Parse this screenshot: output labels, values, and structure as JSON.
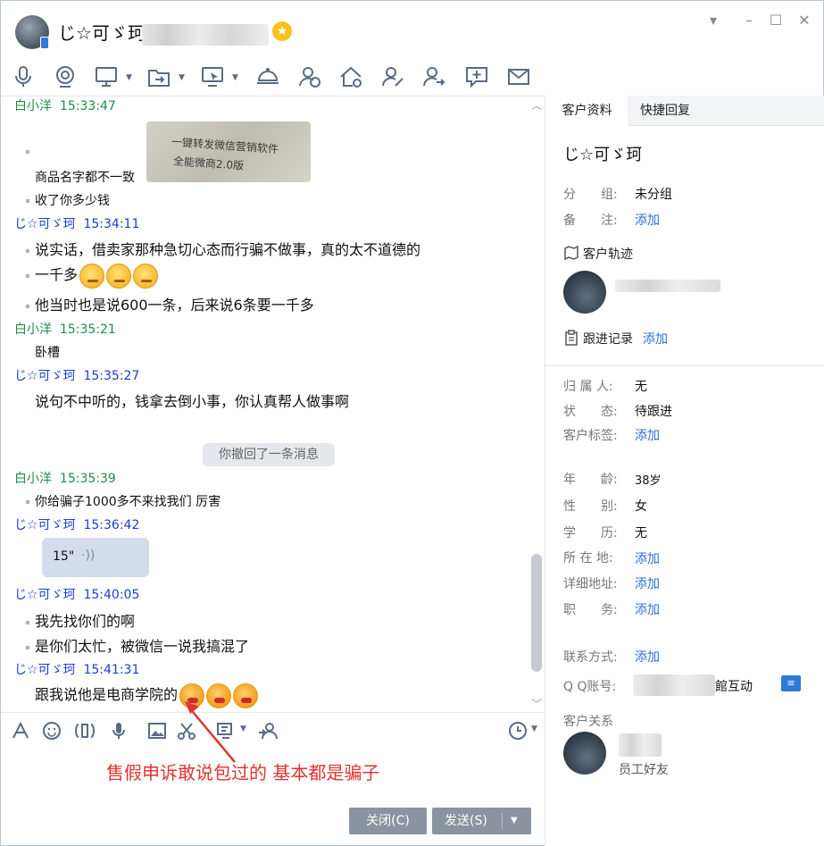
{
  "window": {
    "title": "じ☆可ゞ珂",
    "controls": [
      "chevron-down-icon",
      "minimize-icon",
      "maximize-icon",
      "close-icon"
    ]
  },
  "toolbar": {
    "icons": [
      "microphone-icon",
      "video-icon",
      "screen-share-icon",
      "file-transfer-icon",
      "remote-desktop-icon",
      "service-icon",
      "user-check-icon",
      "home-icon",
      "user-edit-icon",
      "user-transfer-icon",
      "add-comment-icon",
      "mail-icon"
    ]
  },
  "chat": {
    "messages": [
      {
        "sender": "白小洋",
        "time": "15:33:47",
        "side": "me"
      },
      {
        "sender": "じ☆可ゞ珂",
        "time": "15:34:11",
        "side": "other"
      },
      {
        "sender": "白小洋",
        "time": "15:35:21",
        "side": "me"
      },
      {
        "sender": "じ☆可ゞ珂",
        "time": "15:35:27",
        "side": "other"
      },
      {
        "sender": "白小洋",
        "time": "15:35:39",
        "side": "me"
      },
      {
        "sender": "じ☆可ゞ珂",
        "time": "15:36:42",
        "side": "other"
      },
      {
        "sender": "じ☆可ゞ珂",
        "time": "15:40:05",
        "side": "other"
      },
      {
        "sender": "じ☆可ゞ珂",
        "time": "15:41:31",
        "side": "other"
      }
    ],
    "lines": {
      "l1": "商品名字都不一致",
      "l2": "收了你多少钱",
      "l3": "说实话，借卖家那种急切心态而行骗不做事，真的太不道德的",
      "l4": "一千多",
      "l5": "他当时也是说600一条，后来说6条要一千多",
      "l6": "卧槽",
      "l7": "说句不中听的，钱拿去倒小事，你认真帮人做事啊",
      "l8": "你给骗子1000多不来找我们 厉害",
      "l9": "我先找你们的啊",
      "l10": "是你们太忙，被微信一说我搞混了",
      "l11": "跟我说他是电商学院的"
    },
    "image_caption_1": "一键转发微信营销软件",
    "image_caption_2": "全能微商2.0版",
    "recall_notice": "你撤回了一条消息",
    "voice_duration": "15\"",
    "voice_icon": "sound-wave-icon"
  },
  "input": {
    "text": "售假申诉敢说包过的  基本都是骗子",
    "icons": [
      "font-icon",
      "emoji-icon",
      "gif-icon",
      "voice-input-icon",
      "image-icon",
      "scissors-icon",
      "screen-record-icon",
      "transfer-user-icon",
      "clock-icon"
    ],
    "close_button": "关闭(C)",
    "send_button": "发送(S)"
  },
  "panel": {
    "tabs": [
      "客户资料",
      "快捷回复"
    ],
    "customer_name": "じ☆可ゞ珂",
    "group_label": "分　　组:",
    "group_value": "未分组",
    "note_label": "备　　注:",
    "add_link": "添加",
    "trail_title": "客户轨迹",
    "follow_title": "跟进记录",
    "owner_label": "归 属 人:",
    "owner_value": "无",
    "status_label": "状　　态:",
    "status_value": "待跟进",
    "tags_label": "客户标签:",
    "age_label": "年　　龄:",
    "age_value": "38岁",
    "gender_label": "性　　别:",
    "gender_value": "女",
    "edu_label": "学　　历:",
    "edu_value": "无",
    "location_label": "所 在 地:",
    "address_label": "详细地址:",
    "job_label": "职　　务:",
    "contact_label": "联系方式:",
    "qq_label": "Q Q账号:",
    "qq_value_tail": "館互动",
    "relation_title": "客户关系",
    "relation_sub": "员工好友",
    "qq_badge": "card-icon"
  },
  "colors": {
    "me": "#1e8c4a",
    "other": "#1a3fd0",
    "link": "#2d6fd4",
    "annotation": "#e0332f"
  }
}
